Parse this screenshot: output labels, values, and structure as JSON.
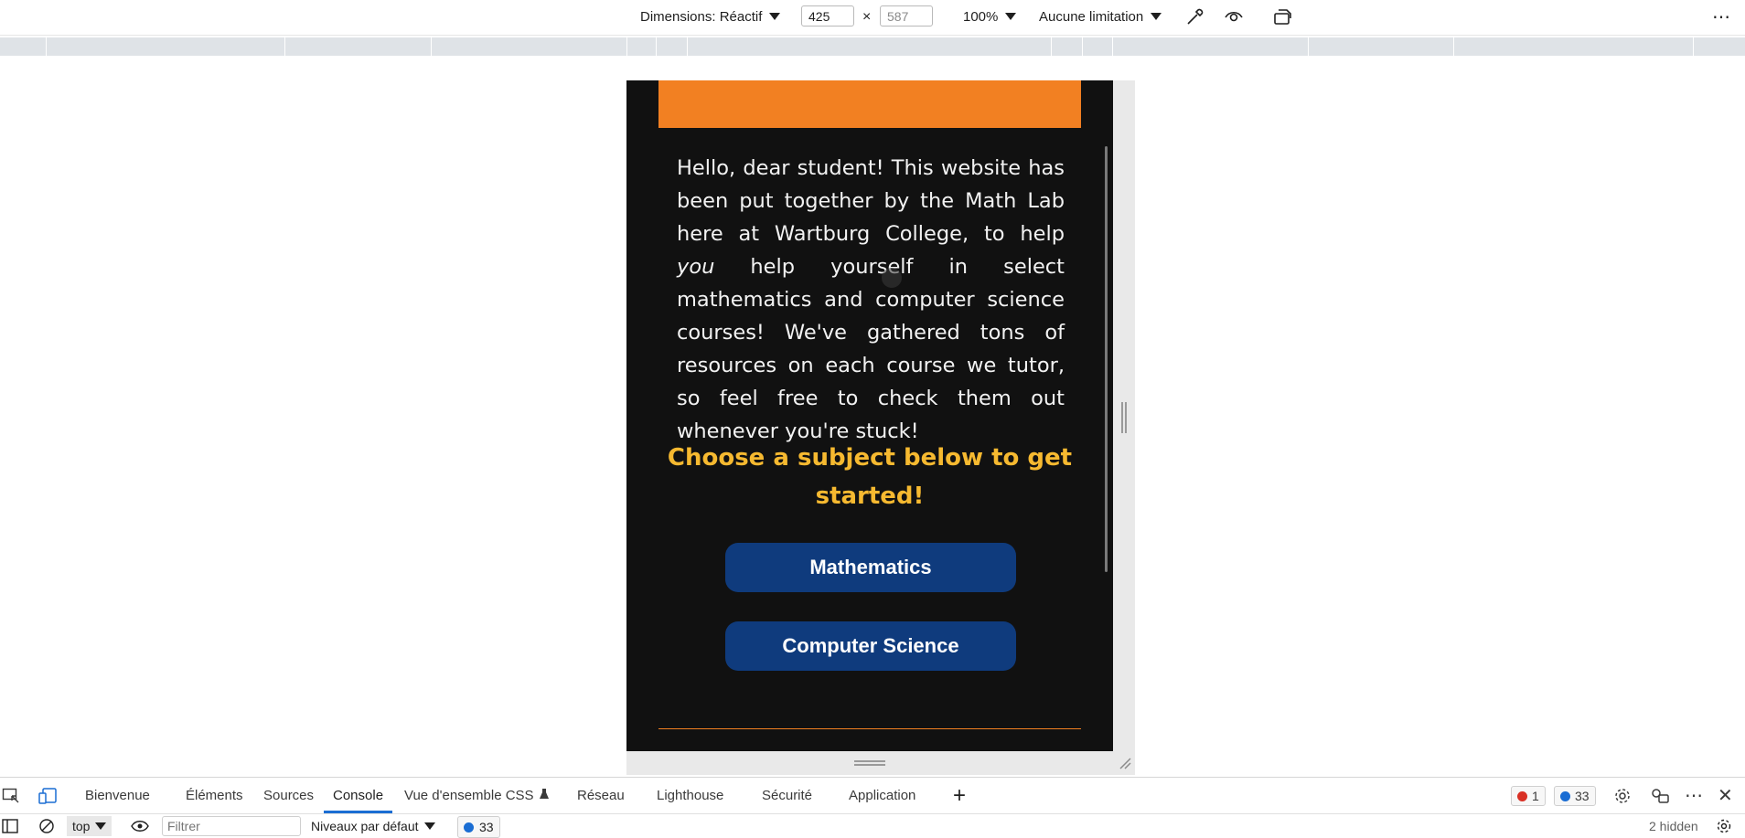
{
  "device_toolbar": {
    "dimensions_label": "Dimensions: Réactif",
    "width_value": "425",
    "height_value": "587",
    "times_symbol": "×",
    "zoom": "100%",
    "throttle": "Aucune limitation",
    "more": "⋯"
  },
  "page": {
    "intro_before": "Hello, dear student! This website has been put together by the Math Lab here at Wartburg College, to help ",
    "intro_emphasis": "you",
    "intro_after": " help yourself in select mathematics and computer science courses! We've gathered tons of resources on each course we tutor, so feel free to check them out whenever you're stuck!",
    "heading": "Choose a subject below to get started!",
    "buttons": [
      "Mathematics",
      "Computer Science"
    ],
    "colors": {
      "banner": "#f28022",
      "heading": "#f6b930",
      "button": "#0f3b7d",
      "background": "#111111"
    }
  },
  "devtools": {
    "tabs": [
      "Bienvenue",
      "Éléments",
      "Sources",
      "Console",
      "Vue d'ensemble CSS",
      "Réseau",
      "Lighthouse",
      "Sécurité",
      "Application"
    ],
    "active_tab": "Console",
    "error_count": "1",
    "message_count": "33",
    "add_tab": "+",
    "close": "✕"
  },
  "console_toolbar": {
    "context": "top",
    "filter_placeholder": "Filtrer",
    "levels": "Niveaux par défaut",
    "message_count": "33",
    "hidden": "2 hidden"
  }
}
